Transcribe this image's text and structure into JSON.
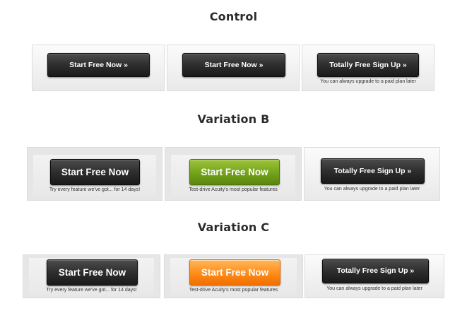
{
  "sections": [
    {
      "title": "Control",
      "cells": [
        {
          "button": "Start Free Now »",
          "color": "dark",
          "caption": ""
        },
        {
          "button": "Start Free Now »",
          "color": "dark",
          "caption": ""
        },
        {
          "button": "Totally Free Sign Up »",
          "color": "dark",
          "caption": "You can always upgrade to a paid plan later"
        }
      ]
    },
    {
      "title": "Variation B",
      "cells": [
        {
          "button": "Start Free Now",
          "color": "dark",
          "caption": "Try every feature we've got... for 14 days!"
        },
        {
          "button": "Start Free Now",
          "color": "green",
          "caption": "Test-drive Acuity's most popular features"
        },
        {
          "button": "Totally Free Sign Up »",
          "color": "dark",
          "caption": "You can always upgrade to a paid plan later"
        }
      ]
    },
    {
      "title": "Variation C",
      "cells": [
        {
          "button": "Start Free Now",
          "color": "dark",
          "caption": "Try every feature we've got... for 14 days!"
        },
        {
          "button": "Start Free Now",
          "color": "orange",
          "caption": "Test-drive Acuity's most popular features"
        },
        {
          "button": "Totally Free Sign Up »",
          "color": "dark",
          "caption": "You can always upgrade to a paid plan later"
        }
      ]
    }
  ],
  "colors": {
    "dark": "#2e2e2e",
    "green": "#73a21a",
    "orange": "#ff8c17",
    "heading": "#2b2b2b"
  }
}
